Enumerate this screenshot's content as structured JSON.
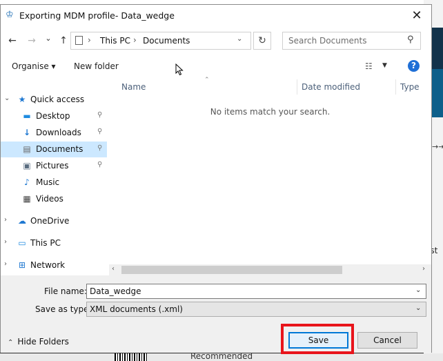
{
  "window": {
    "title": "Exporting MDM profile- Data_wedge",
    "close_glyph": "✕"
  },
  "nav": {
    "back_glyph": "←",
    "forward_glyph": "→",
    "recent_glyph": "⌄",
    "up_glyph": "↑",
    "breadcrumb": [
      "This PC",
      "Documents"
    ],
    "refresh_glyph": "↻",
    "search_placeholder": "Search Documents"
  },
  "toolbar": {
    "organise_label": "Organise ▾",
    "new_folder_label": "New folder",
    "help_glyph": "?"
  },
  "sidebar": {
    "items": [
      {
        "label": "Quick access",
        "icon": "star-icon",
        "expander": "⌄",
        "pinned": false
      },
      {
        "label": "Desktop",
        "icon": "desktop-icon",
        "pinned": true
      },
      {
        "label": "Downloads",
        "icon": "download-icon",
        "pinned": true
      },
      {
        "label": "Documents",
        "icon": "document-icon",
        "pinned": true,
        "selected": true
      },
      {
        "label": "Pictures",
        "icon": "picture-icon",
        "pinned": true
      },
      {
        "label": "Music",
        "icon": "music-icon",
        "pinned": false
      },
      {
        "label": "Videos",
        "icon": "video-icon",
        "pinned": false
      },
      {
        "label": "OneDrive",
        "icon": "cloud-icon",
        "expander": "›"
      },
      {
        "label": "This PC",
        "icon": "computer-icon",
        "expander": "›"
      },
      {
        "label": "Network",
        "icon": "network-icon",
        "expander": "›"
      }
    ]
  },
  "filelist": {
    "columns": [
      "Name",
      "Date modified",
      "Type"
    ],
    "empty_message": "No items match your search."
  },
  "form": {
    "file_name_label": "File name:",
    "file_name_value": "Data_wedge",
    "save_type_label": "Save as type:",
    "save_type_value": "XML documents (.xml)",
    "hide_folders_label": "Hide Folders",
    "save_label": "Save",
    "cancel_label": "Cancel"
  },
  "background": {
    "right_text": "est",
    "bottom_text": "Recommended",
    "arrow_text": "→⇥"
  },
  "colors": {
    "accent": "#0078d7",
    "selection": "#cce8ff",
    "highlight": "#e8141b",
    "help": "#1f6fd6"
  }
}
